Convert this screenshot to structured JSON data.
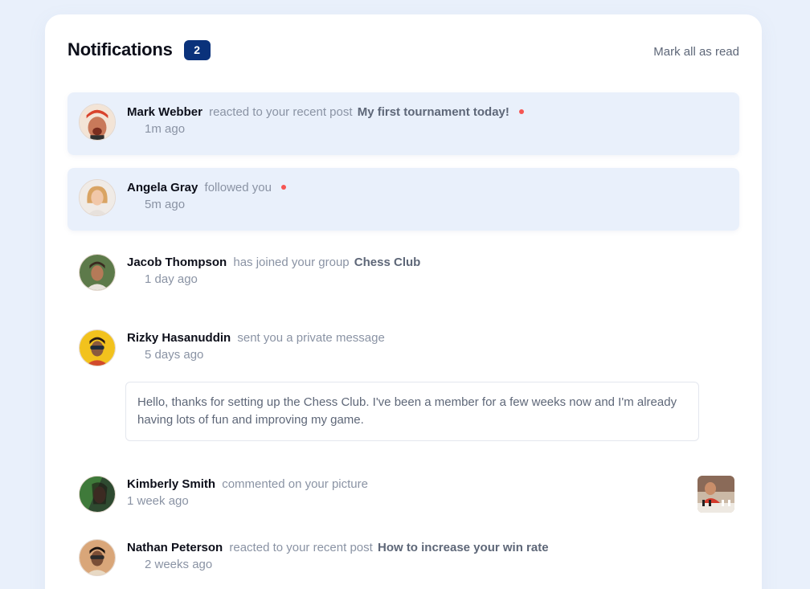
{
  "header": {
    "title": "Notifications",
    "badge_count": "2",
    "mark_all_label": "Mark all as read"
  },
  "colors": {
    "background": "#e9f0fb",
    "card": "#ffffff",
    "badge": "#0a327b",
    "unread_bg": "#e9f0fb",
    "unread_dot": "#f65552",
    "name_text": "#0d0f1a",
    "muted_text": "#8a93a4",
    "target_text": "#5e6778"
  },
  "notifications": [
    {
      "name": "Mark Webber",
      "action": "reacted to your recent post",
      "target": "My first tournament today!",
      "time": "1m ago",
      "unread": true
    },
    {
      "name": "Angela Gray",
      "action": "followed you",
      "target": "",
      "time": "5m ago",
      "unread": true
    },
    {
      "name": "Jacob Thompson",
      "action": "has joined your group",
      "target": "Chess Club",
      "time": "1 day ago",
      "unread": false
    },
    {
      "name": "Rizky Hasanuddin",
      "action": "sent you a private message",
      "target": "",
      "time": "5 days ago",
      "unread": false,
      "message": "Hello, thanks for setting up the Chess Club. I've been a member for a few weeks now and I'm already having lots of fun and improving my game."
    },
    {
      "name": "Kimberly Smith",
      "action": "commented on your picture",
      "target": "",
      "time": "1 week ago",
      "unread": false
    },
    {
      "name": "Nathan Peterson",
      "action": "reacted to your recent post",
      "target": "How to increase your win rate",
      "time": "2 weeks ago",
      "unread": false
    }
  ]
}
